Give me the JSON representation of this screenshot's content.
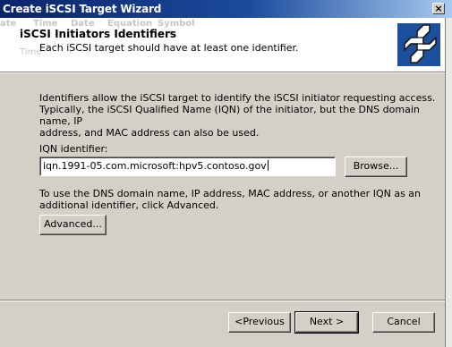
{
  "window": {
    "title": "Create iSCSI Target Wizard",
    "close_glyph": "×"
  },
  "background_ghost": {
    "headers": [
      "ate",
      "Time",
      "Date",
      "Equation",
      "Symbol"
    ],
    "subheader": "Time"
  },
  "header": {
    "title": "iSCSI Initiators Identifiers",
    "subtitle": "Each iSCSI target should have at least one identifier.",
    "icon": "iscsi-target-wizard-icon"
  },
  "body": {
    "intro_lines": [
      "Identifiers allow the iSCSI target to identify the iSCSI initiator requesting access.",
      "Typically, the iSCSI Qualified Name (IQN) of the initiator, but the DNS domain name, IP",
      "address, and MAC address can also be used."
    ],
    "iqn_label": "IQN identifier:",
    "iqn_value": "iqn.1991-05.com.microsoft:hpv5.contoso.gov",
    "browse_button": "Browse...",
    "advanced_hint_lines": [
      "To use the DNS domain name, IP address, MAC address, or another IQN as an",
      "additional identifier, click Advanced."
    ],
    "advanced_button": "Advanced..."
  },
  "footer": {
    "previous_button": "<Previous",
    "next_button": "Next >",
    "cancel_button": "Cancel"
  },
  "colors": {
    "titlebar_start": "#0a246a",
    "titlebar_end": "#a6caf0",
    "dialog_face": "#d4d0c8",
    "icon_blue": "#1c4f9e"
  }
}
